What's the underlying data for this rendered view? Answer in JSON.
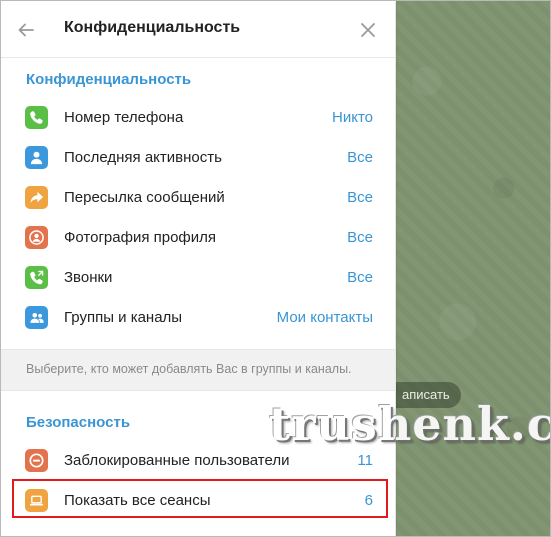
{
  "header": {
    "title": "Конфиденциальность"
  },
  "privacy_section": {
    "title": "Конфиденциальность",
    "items": [
      {
        "label": "Номер телефона",
        "value": "Никто",
        "icon": "phone-icon",
        "color": "#5bbf47"
      },
      {
        "label": "Последняя активность",
        "value": "Все",
        "icon": "user-icon",
        "color": "#3b98dd"
      },
      {
        "label": "Пересылка сообщений",
        "value": "Все",
        "icon": "forward-icon",
        "color": "#f0a341"
      },
      {
        "label": "Фотография профиля",
        "value": "Все",
        "icon": "profile-photo-icon",
        "color": "#e3734c"
      },
      {
        "label": "Звонки",
        "value": "Все",
        "icon": "call-icon",
        "color": "#5bbf47"
      },
      {
        "label": "Группы и каналы",
        "value": "Мои контакты",
        "icon": "group-icon",
        "color": "#3b98dd"
      }
    ],
    "hint": "Выберите, кто может добавлять Вас в группы и каналы."
  },
  "security_section": {
    "title": "Безопасность",
    "items": [
      {
        "label": "Заблокированные пользователи",
        "value": "11",
        "icon": "block-icon",
        "color": "#e3734c"
      },
      {
        "label": "Показать все сеансы",
        "value": "6",
        "icon": "laptop-icon",
        "color": "#f0a341"
      }
    ]
  },
  "chat": {
    "button_partial": "аписать"
  },
  "watermark": "trushenk.com",
  "colors": {
    "accent": "#3a95d5",
    "highlight": "#e01b1b"
  }
}
